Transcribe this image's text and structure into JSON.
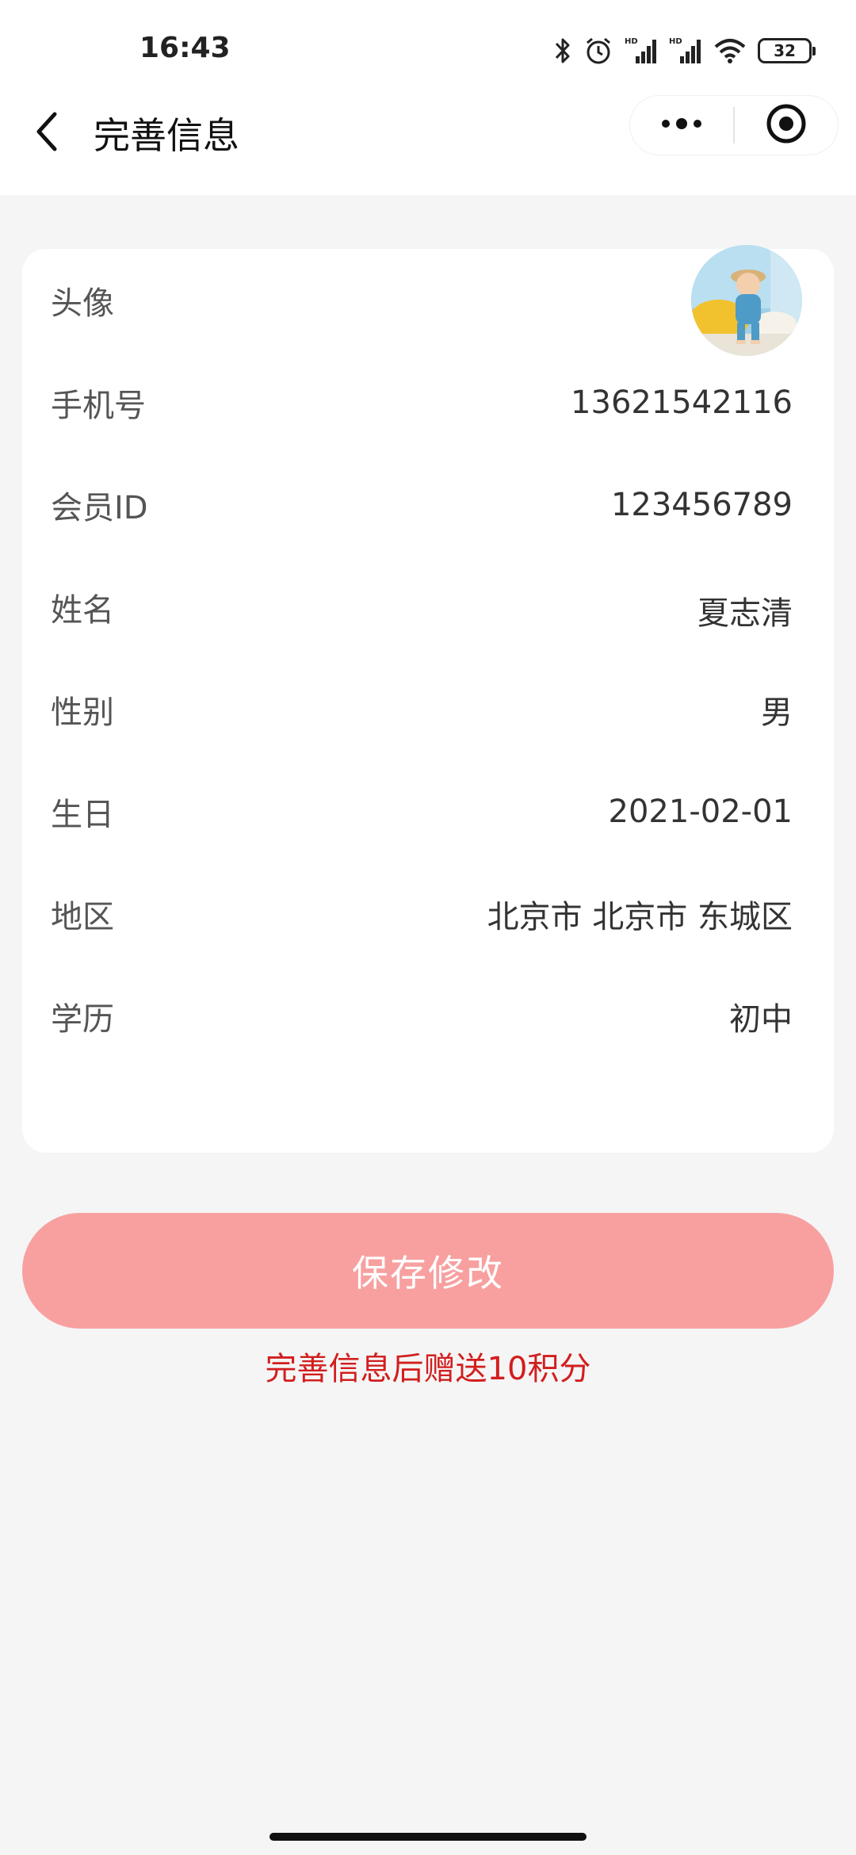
{
  "status_bar": {
    "time": "16:43",
    "battery": "32",
    "icons": [
      "bluetooth-icon",
      "alarm-icon",
      "hd-signal-icon",
      "hd-signal-icon",
      "wifi-icon",
      "battery-icon"
    ]
  },
  "nav": {
    "title": "完善信息",
    "back_icon": "chevron-left-icon",
    "more_icon": "more-dots-icon",
    "close_icon": "target-circle-icon"
  },
  "profile": {
    "avatar_label": "头像",
    "rows": [
      {
        "label": "手机号",
        "value": "13621542116"
      },
      {
        "label": "会员ID",
        "value": "123456789"
      },
      {
        "label": "姓名",
        "value": "夏志清"
      },
      {
        "label": "性别",
        "value": "男"
      },
      {
        "label": "生日",
        "value": "2021-02-01"
      },
      {
        "label": "地区",
        "value": "北京市 北京市 东城区"
      },
      {
        "label": "学历",
        "value": "初中"
      }
    ]
  },
  "actions": {
    "save_label": "保存修改",
    "reward_note": "完善信息后赠送10积分"
  },
  "colors": {
    "accent_button": "#f8a0a0",
    "note_red": "#d21e1e",
    "background": "#f5f5f5"
  }
}
